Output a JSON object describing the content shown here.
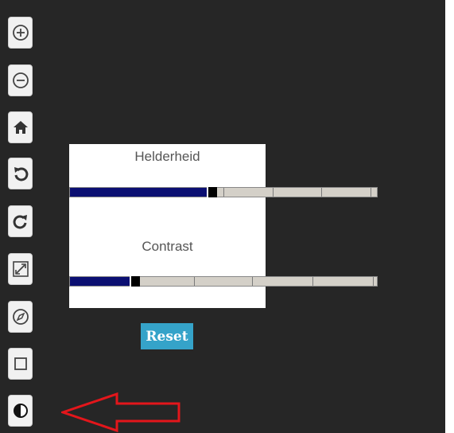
{
  "toolbar": {
    "buttons": [
      {
        "icon": "zoom-in-icon"
      },
      {
        "icon": "zoom-out-icon"
      },
      {
        "icon": "home-icon"
      },
      {
        "icon": "rotate-left-icon"
      },
      {
        "icon": "rotate-right-icon"
      },
      {
        "icon": "fullscreen-icon"
      },
      {
        "icon": "compass-icon"
      },
      {
        "icon": "square-icon"
      },
      {
        "icon": "contrast-icon"
      }
    ]
  },
  "adjust_panel": {
    "brightness": {
      "label": "Helderheid",
      "value_fraction": 0.45
    },
    "contrast": {
      "label": "Contrast",
      "value_fraction": 0.2
    },
    "reset_label": "Reset"
  },
  "annotation": {
    "arrow_color": "#e3161b",
    "points_to": "contrast-icon"
  },
  "colors": {
    "background": "#262626",
    "slider_fill": "#0b0f72",
    "slider_track": "#d4d0c8",
    "reset_button": "#35a3c9"
  }
}
